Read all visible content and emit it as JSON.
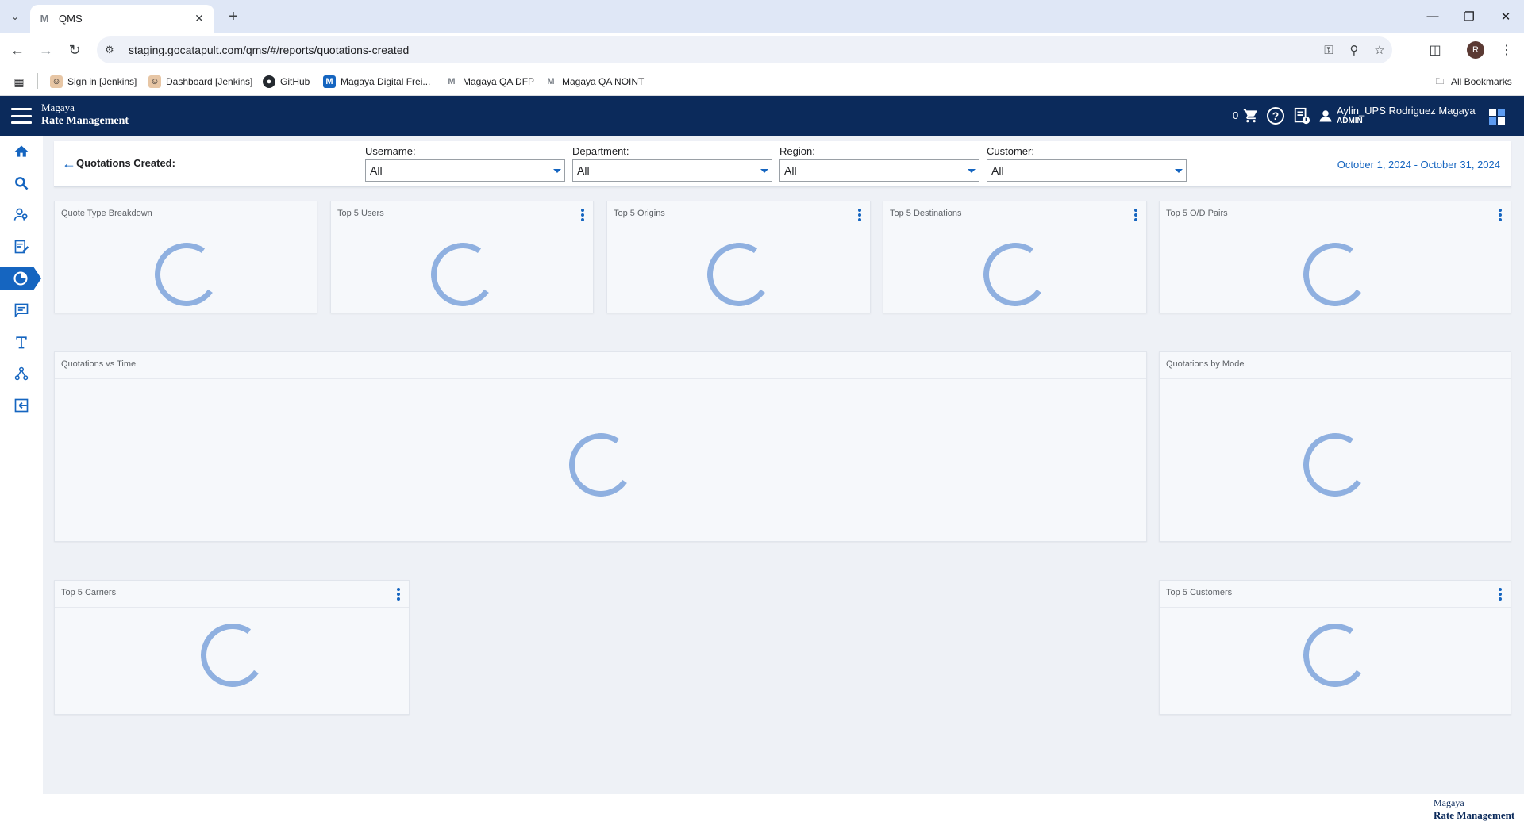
{
  "browser": {
    "tab_title": "QMS",
    "url": "staging.gocatapult.com/qms/#/reports/quotations-created",
    "profile_initial": "R",
    "bookmarks": [
      {
        "label": "Sign in [Jenkins]",
        "icon": "jenkins-icon"
      },
      {
        "label": "Dashboard [Jenkins]",
        "icon": "jenkins-icon"
      },
      {
        "label": "GitHub",
        "icon": "github-icon"
      },
      {
        "label": "Magaya Digital Frei...",
        "icon": "magaya-icon"
      },
      {
        "label": "Magaya QA DFP",
        "icon": "magaya-icon"
      },
      {
        "label": "Magaya QA NOINT",
        "icon": "magaya-icon"
      }
    ],
    "all_bookmarks": "All Bookmarks"
  },
  "app": {
    "brand_line1": "Magaya",
    "brand_line2": "Rate Management",
    "cart_count": "0",
    "user_name": "Aylin_UPS Rodriguez Magaya",
    "user_role": "ADMIN",
    "accent": "#1565c0",
    "header_bg": "#0b2a5b"
  },
  "sidebar": {
    "items": [
      {
        "icon": "home-icon",
        "active": false
      },
      {
        "icon": "search-icon",
        "active": false
      },
      {
        "icon": "users-icon",
        "active": false
      },
      {
        "icon": "edit-document-icon",
        "active": false
      },
      {
        "icon": "pie-chart-icon",
        "active": true
      },
      {
        "icon": "chat-icon",
        "active": false
      },
      {
        "icon": "text-icon",
        "active": false
      },
      {
        "icon": "network-icon",
        "active": false
      },
      {
        "icon": "import-icon",
        "active": false
      }
    ]
  },
  "filters": {
    "title": "Quotations Created:",
    "username": {
      "label": "Username:",
      "value": "All"
    },
    "department": {
      "label": "Department:",
      "value": "All"
    },
    "region": {
      "label": "Region:",
      "value": "All"
    },
    "customer": {
      "label": "Customer:",
      "value": "All"
    },
    "date_range": "October 1, 2024 - October 31, 2024"
  },
  "cards": {
    "quote_type": "Quote Type Breakdown",
    "top_users": "Top 5 Users",
    "top_origins": "Top 5 Origins",
    "top_destinations": "Top 5 Destinations",
    "top_od_pairs": "Top 5 O/D Pairs",
    "quotations_vs_time": "Quotations vs Time",
    "quotations_by_mode": "Quotations by Mode",
    "top_carriers": "Top 5 Carriers",
    "top_customers": "Top 5 Customers"
  },
  "footer": {
    "brand_line1": "Magaya",
    "brand_line2": "Rate Management"
  }
}
